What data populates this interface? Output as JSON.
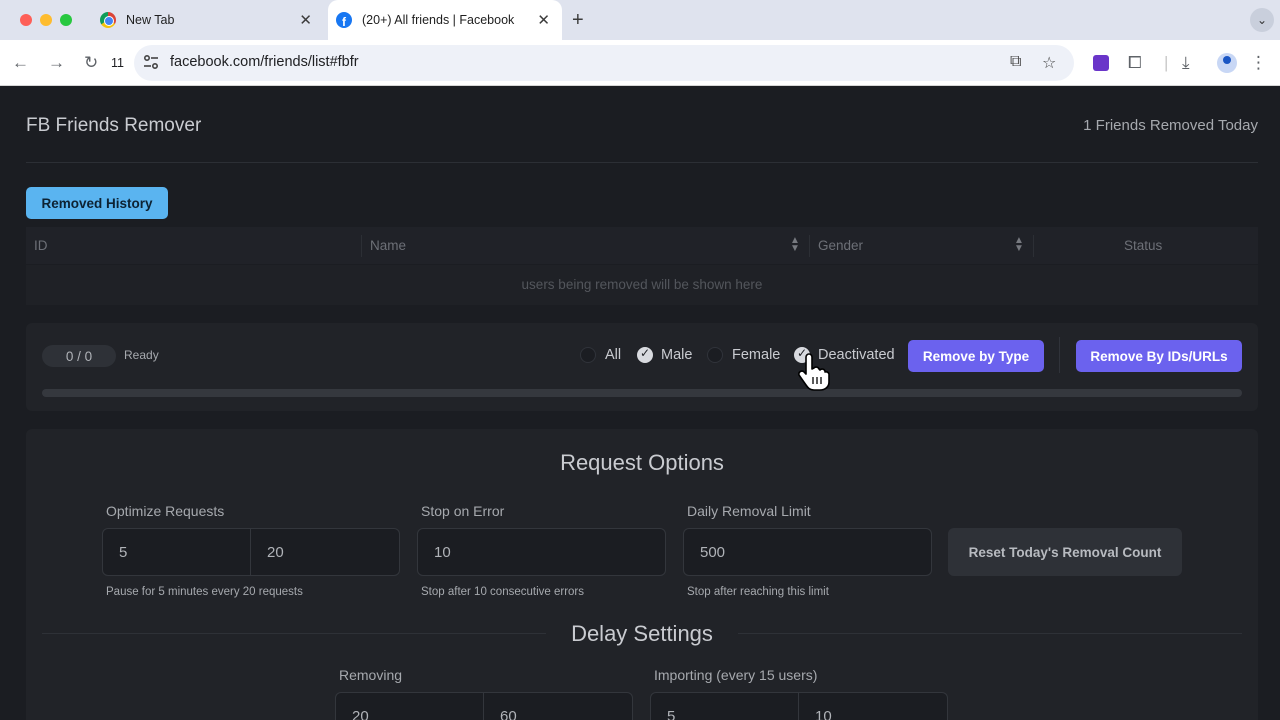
{
  "browser": {
    "tabs": [
      {
        "title": "New Tab"
      },
      {
        "title": "(20+) All friends | Facebook"
      }
    ],
    "reload_badge": "11",
    "url": "facebook.com/friends/list#fbfr"
  },
  "app": {
    "title": "FB Friends Remover",
    "removed_today": "1 Friends Removed Today",
    "history_button": "Removed History",
    "table": {
      "columns": [
        "ID",
        "Name",
        "Gender",
        "Status"
      ],
      "empty_message": "users being removed will be shown here"
    },
    "controls": {
      "counter": "0 / 0",
      "status": "Ready",
      "progress": 0,
      "filters": [
        {
          "label": "All",
          "checked": false
        },
        {
          "label": "Male",
          "checked": true
        },
        {
          "label": "Female",
          "checked": false
        },
        {
          "label": "Deactivated",
          "checked": true
        }
      ],
      "remove_by_type": "Remove by Type",
      "remove_by_ids": "Remove By IDs/URLs"
    },
    "request_options": {
      "title": "Request Options",
      "optimize": {
        "label": "Optimize Requests",
        "value1": "5",
        "value2": "20",
        "hint": "Pause for 5 minutes every 20 requests"
      },
      "stop_on_error": {
        "label": "Stop on Error",
        "value": "10",
        "hint": "Stop after 10 consecutive errors"
      },
      "daily_limit": {
        "label": "Daily Removal Limit",
        "value": "500",
        "hint": "Stop after reaching this limit"
      },
      "reset_button": "Reset Today's Removal Count"
    },
    "delay_settings": {
      "title": "Delay Settings",
      "removing": {
        "label": "Removing",
        "min": "20",
        "max": "60"
      },
      "importing": {
        "label": "Importing (every 15 users)",
        "min": "5",
        "max": "10"
      }
    }
  },
  "colors": {
    "accent": "#6b62ee",
    "history_button": "#5ab4f0",
    "background": "#1b1d22"
  }
}
